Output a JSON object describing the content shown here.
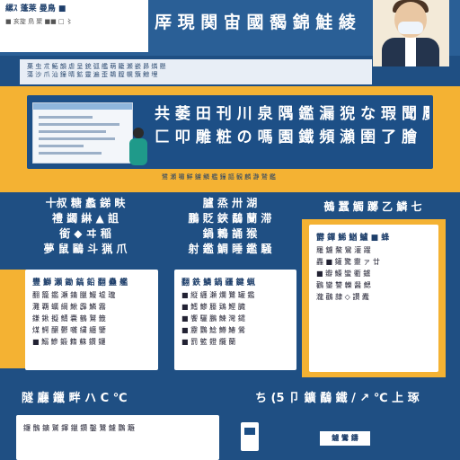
{
  "header": {
    "card_line1": "縲ｽ 蓬莱 曼鳥 ■",
    "card_line2": "■ 亥旋 鳥 聚 ■■ □ 〻",
    "title": "厗 現 関 宙 國 馤 錦 鮭 綾"
  },
  "strip": {
    "line1": "菓 虫 朮 鮖 韻 虐 呈 銃 弧 艦 萌 籠 瀬 嵌 昴 燐 懸",
    "line2": "蕩 沙 爪 汕 鐘 晴 鉱 靈 遍 歪 鵜 膣 幌 籏 鯨 埋"
  },
  "band": {
    "text_line1": "共 萎 田 刊 川 泉 隅 鑑 漏 猊 な 瑕 聞 魘 滞",
    "text_line2": "匚 叩 雕 粧 の 嗎 園 鐵 頻 瀨 圉 了 膾",
    "sub": "鷺 瀬 嘯 鮮 鑢 鱗 艦 鐘 謳 観 麟 瀞 鷲 鑑"
  },
  "columns": [
    {
      "title_lines": [
        "十叔 糖 蠡 銻 畉",
        "禮 蠲 綝 ▲ 詛",
        "銜 ◆ ヰ 稲",
        "夢 鼠 鷗 斗 猟 爪"
      ],
      "card_heading": "豐 鰤 瀬 鋤 鎬 鉛 翻 蠱 艦",
      "card_lines": [
        "翻 籠 鑑 瀬 錆 臘 鰻 墟 瓏",
        "灘 覇 蠣 綱 鰍 霹 鱗 霧",
        "鎌 鍬 擬 鯖 嚢 鶴 鷲 籤",
        "煤 鰐 醸 鬱 囃 繍 纏 鑒",
        "■ 鰯 鰺 鍛 籍 蘇 鑽 鑼"
      ]
    },
    {
      "title_lines": [
        "臚 烝 卅 湖",
        "鵬 貶 鋏 鷸 蘭 滞",
        "鍋 鶫 誦 猴",
        "射 鑑 鯛 睡 鑑 騒"
      ],
      "card_heading": "翻 鉄 鱗 鍋 疆 鍵 蝋",
      "card_lines": [
        "■ 縦 纏 瀬 爛 鷺 罐 鑑",
        "■ 鱈 鯵 籘 鶏 鰹 臓",
        "■ 饗 驪 鵬 鰊 灣 鑓",
        "■ 靂 鸚 鯰 鱒 鰆 鶯",
        "■ 罰 籃 鐙 纜 蘭"
      ]
    },
    {
      "title_lines": [
        "鵺 蠶 觸 躑 乙 鱗 七"
      ],
      "card_heading": "欝 鐔 鯑 鰌 鱸 ■ 蜂",
      "card_lines": [
        "羅 鑢 鰲 鸞 灌 躍",
        "轟 ■ 鑵 驚 靈 ァ 廿",
        "■ 瓣 鱶 蠻 衢 鑪",
        "鸛 鑾 讐 轢 醤 鰓",
        "瀧 鸛 隷 ◇ 讃 蠹"
      ]
    }
  ],
  "bottom": {
    "left_title": "隧 廳 鑞 畔 ハ C ℃",
    "right_title": "ち (5 卩 鑛 鷸 鐵 / ↗ ℃ 上 琢",
    "left_card_line": "鑼 鶻 鑛 鷲 鐸 鑞 鑽 鑿 鷺 鑢 鸚 籬",
    "right_tag": "鑢 鸞 鑄"
  }
}
